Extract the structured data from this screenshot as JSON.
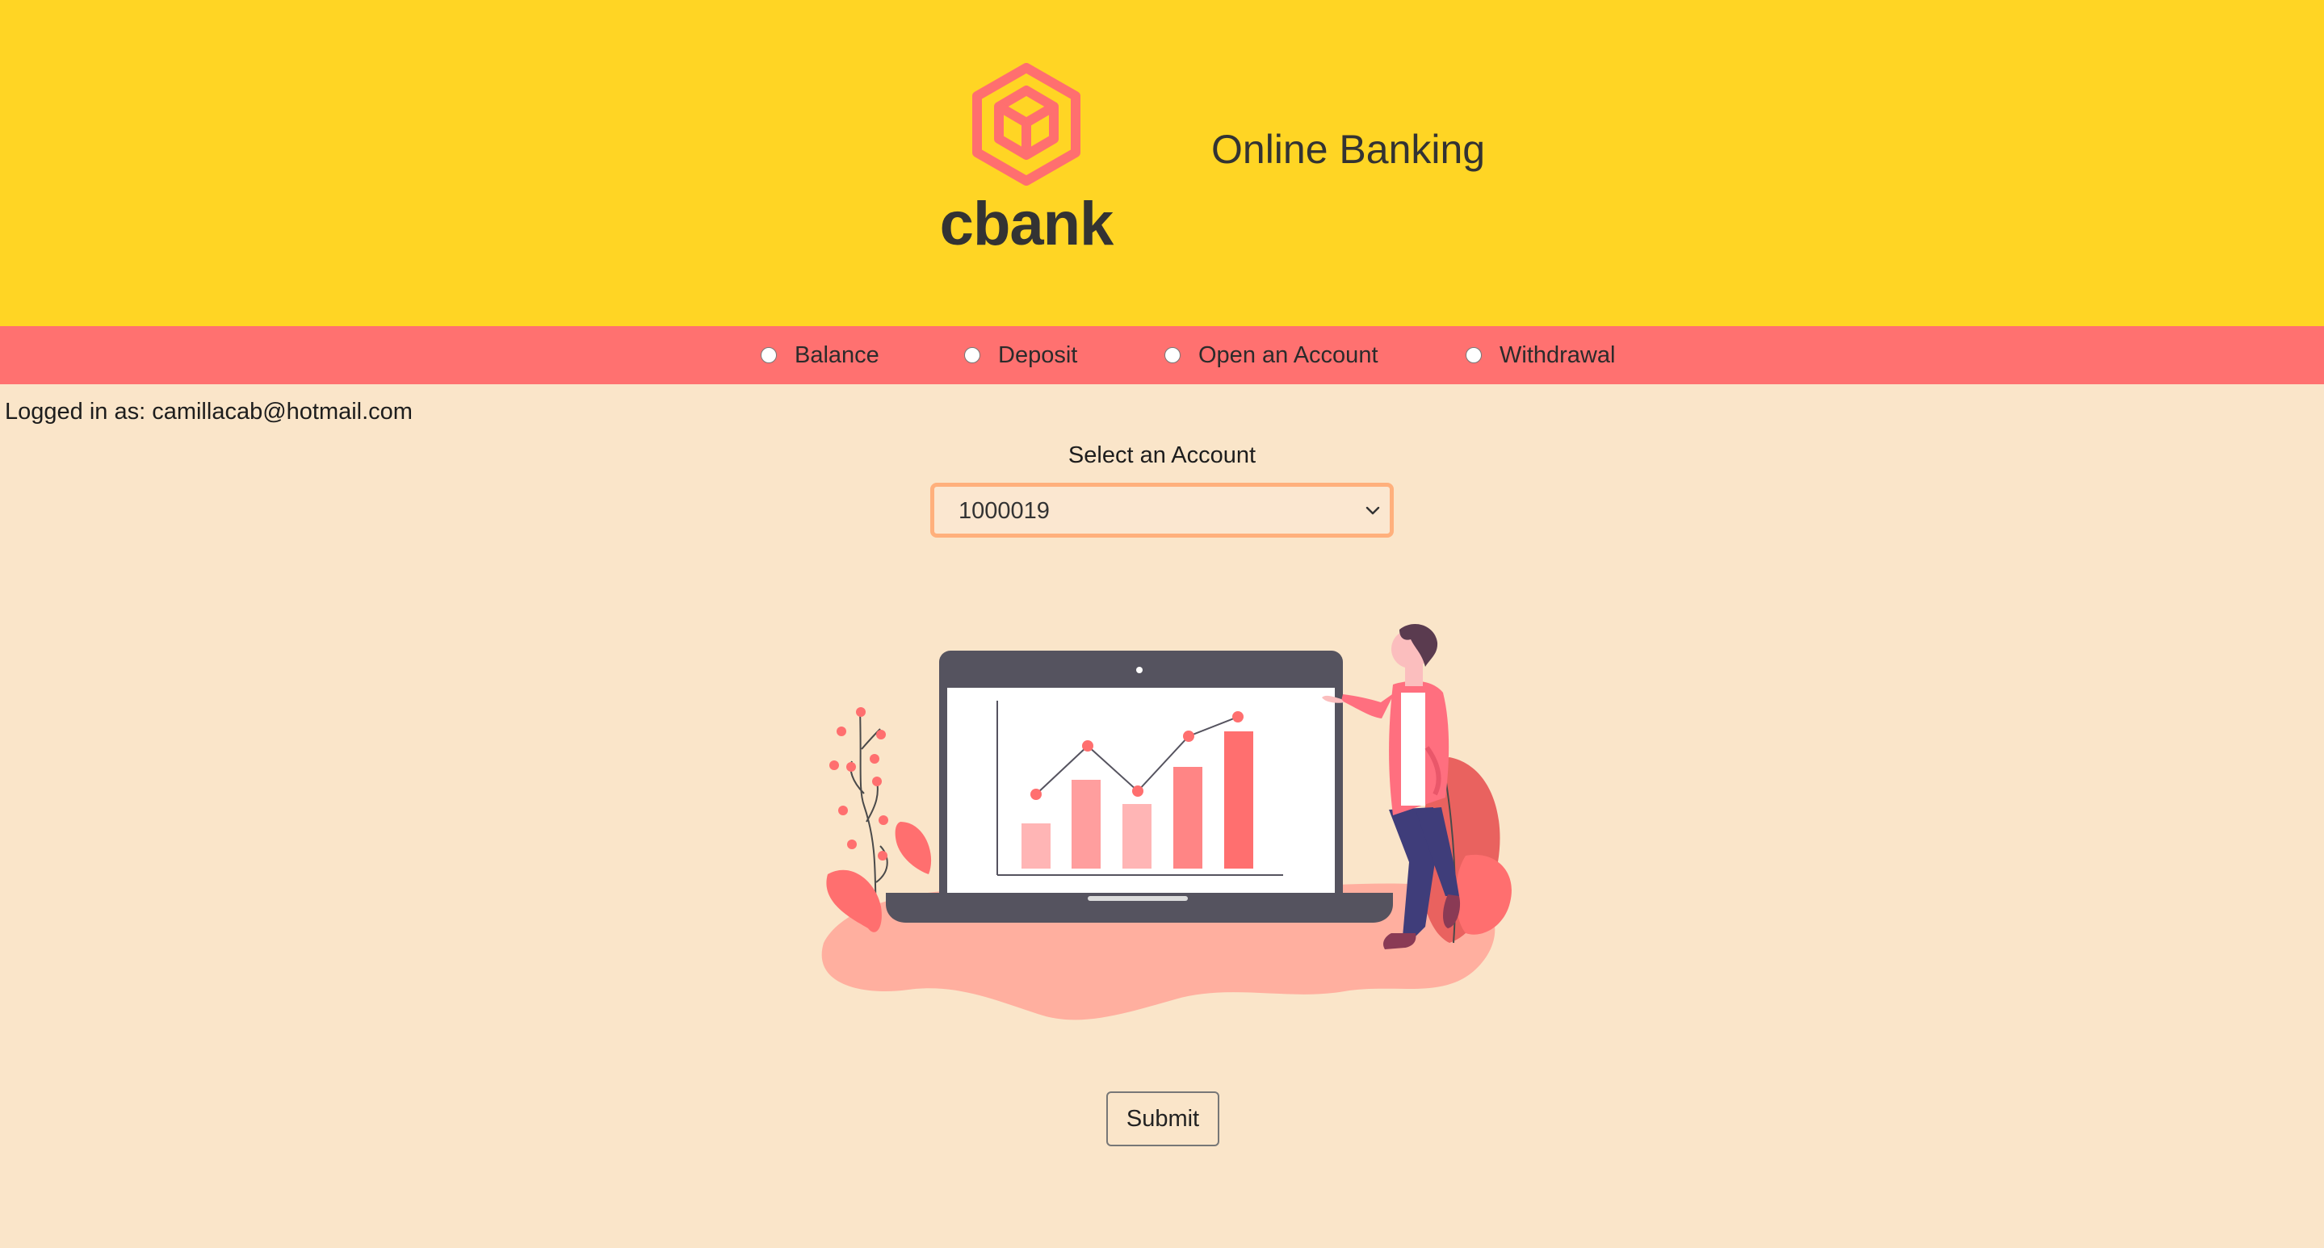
{
  "header": {
    "brand": "cbank",
    "title": "Online Banking",
    "logo_icon": "cube-hexagon-icon",
    "colors": {
      "header_bg": "#ffd524",
      "logo": "#ff6f6f"
    }
  },
  "nav": {
    "bg_color": "#ff7170",
    "options": [
      {
        "label": "Balance"
      },
      {
        "label": "Deposit"
      },
      {
        "label": "Open an Account"
      },
      {
        "label": "Withdrawal"
      }
    ]
  },
  "session": {
    "logged_in_text": "Logged in as: camillacab@hotmail.com"
  },
  "account_select": {
    "label": "Select an Account",
    "value": "1000019"
  },
  "illustration": {
    "icon": "laptop-chart-presenter-illustration"
  },
  "form": {
    "submit_label": "Submit"
  },
  "page": {
    "bg_color": "#fae5c9"
  }
}
